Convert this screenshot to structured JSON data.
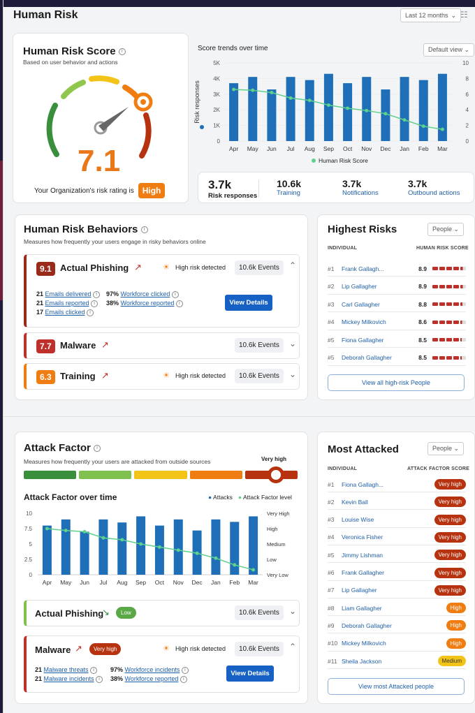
{
  "header": {
    "title": "Human Risk",
    "period": "Last 12 months"
  },
  "score_card": {
    "title": "Human Risk Score",
    "subtitle": "Based on user behavior and actions",
    "value": "7.1",
    "rating_text": "Your Organization's risk rating is",
    "rating": "High"
  },
  "trend": {
    "title": "Score trends over time",
    "view": "Default view",
    "ylabel": "Risk responses",
    "legend": "Human Risk Score",
    "stats": [
      {
        "value": "3.7k",
        "label": "Risk responses"
      },
      {
        "value": "10.6k",
        "label": "Training"
      },
      {
        "value": "3.7k",
        "label": "Notifications"
      },
      {
        "value": "3.7k",
        "label": "Outbound actions"
      }
    ]
  },
  "chart_data": [
    {
      "type": "bar",
      "title": "Score trends over time",
      "ylabel": "Risk responses",
      "categories": [
        "Apr",
        "May",
        "Jun",
        "Jul",
        "Aug",
        "Sep",
        "Oct",
        "Nov",
        "Dec",
        "Jan",
        "Feb",
        "Mar"
      ],
      "ylim": [
        0,
        5000
      ],
      "y2lim": [
        0,
        10
      ],
      "y_ticks": [
        "0",
        "1K",
        "2K",
        "3K",
        "4K",
        "5K"
      ],
      "y2_ticks": [
        "0",
        "2",
        "4",
        "6",
        "8",
        "10"
      ],
      "series": [
        {
          "name": "Risk responses",
          "values": [
            3700,
            4100,
            3300,
            4100,
            3900,
            4300,
            3700,
            4100,
            3300,
            4100,
            3900,
            4300
          ]
        },
        {
          "name": "Human Risk Score",
          "type": "line",
          "values": [
            6.6,
            6.5,
            6.2,
            5.5,
            5.2,
            4.6,
            4.2,
            3.9,
            3.5,
            2.7,
            1.9,
            1.5
          ]
        }
      ]
    },
    {
      "type": "bar",
      "title": "Attack Factor over time",
      "categories": [
        "Apr",
        "May",
        "Jun",
        "Jul",
        "Aug",
        "Sep",
        "Oct",
        "Nov",
        "Dec",
        "Jan",
        "Feb",
        "Mar"
      ],
      "ylim": [
        0,
        10
      ],
      "y_ticks": [
        "0",
        "2.5",
        "5",
        "7.5",
        "10"
      ],
      "y2_ticks": [
        "Very Low",
        "Low",
        "Medium",
        "High",
        "Very High"
      ],
      "series": [
        {
          "name": "Attacks",
          "values": [
            8.0,
            9.0,
            7.0,
            9.0,
            8.5,
            9.5,
            8.0,
            9.0,
            7.2,
            9.0,
            8.6,
            9.5
          ]
        },
        {
          "name": "Attack Factor level",
          "type": "line",
          "values": [
            7.5,
            7.2,
            7.0,
            6.0,
            5.7,
            5.0,
            4.5,
            4.0,
            3.5,
            2.7,
            1.6,
            0.8
          ]
        }
      ]
    }
  ],
  "behaviors": {
    "title": "Human Risk Behaviors",
    "subtitle": "Measures how frequently your users engage in risky behaviors online",
    "items": [
      {
        "score": "9.1",
        "name": "Actual Phishing",
        "alert": "High risk detected",
        "events": "10.6k Events",
        "stats_left": [
          {
            "num": "21",
            "label": "Emails delivered"
          },
          {
            "num": "21",
            "label": "Emails reported"
          },
          {
            "num": "17",
            "label": "Emails clicked"
          }
        ],
        "stats_right": [
          {
            "num": "97%",
            "label": "Workforce clicked"
          },
          {
            "num": "38%",
            "label": "Workforce reported"
          }
        ],
        "button": "View Details"
      },
      {
        "score": "7.7",
        "name": "Malware",
        "events": "10.6k Events"
      },
      {
        "score": "6.3",
        "name": "Training",
        "alert": "High risk detected",
        "events": "10.6k Events"
      }
    ]
  },
  "highest": {
    "title": "Highest Risks",
    "filter": "People",
    "col1": "INDIVIDUAL",
    "col2": "HUMAN RISK SCORE",
    "button": "View all high-risk People",
    "rows": [
      {
        "rank": "#1",
        "name": "Frank Gallagh...",
        "score": "8.9"
      },
      {
        "rank": "#2",
        "name": "Lip Gallagher",
        "score": "8.9"
      },
      {
        "rank": "#3",
        "name": "Carl Gallagher",
        "score": "8.8"
      },
      {
        "rank": "#4",
        "name": "Mickey Milkovich",
        "score": "8.6"
      },
      {
        "rank": "#5",
        "name": "Fiona Gallagher",
        "score": "8.5"
      },
      {
        "rank": "#5",
        "name": "Deborah Gallagher",
        "score": "8.5"
      }
    ]
  },
  "attack": {
    "title": "Attack Factor",
    "subtitle": "Measures how frequently your users are attacked from outside sources",
    "level": "Very high",
    "chart_title": "Attack Factor over time",
    "legend1": "Attacks",
    "legend2": "Attack Factor level",
    "items": [
      {
        "name": "Actual Phishing",
        "badge": "Low",
        "events": "10.6k Events"
      },
      {
        "name": "Malware",
        "badge": "Very high",
        "alert": "High risk detected",
        "events": "10.6k Events",
        "stats_left": [
          {
            "num": "21",
            "label": "Malware threats"
          },
          {
            "num": "21",
            "label": "Malware incidents"
          }
        ],
        "stats_right": [
          {
            "num": "97%",
            "label": "Workforce incidents"
          },
          {
            "num": "38%",
            "label": "Workforce reported"
          }
        ],
        "button": "View Details"
      }
    ]
  },
  "attacked": {
    "title": "Most Attacked",
    "filter": "People",
    "col1": "INDIVIDUAL",
    "col2": "ATTACK FACTOR SCORE",
    "button": "View most Attacked people",
    "rows": [
      {
        "rank": "#1",
        "name": "Fiona Gallagh...",
        "level": "Very high"
      },
      {
        "rank": "#2",
        "name": "Kevin Ball",
        "level": "Very high"
      },
      {
        "rank": "#3",
        "name": "Louise Wise",
        "level": "Very high"
      },
      {
        "rank": "#4",
        "name": "Veronica Fisher",
        "level": "Very high"
      },
      {
        "rank": "#5",
        "name": "Jimmy Lishman",
        "level": "Very high"
      },
      {
        "rank": "#6",
        "name": "Frank Gallagher",
        "level": "Very high"
      },
      {
        "rank": "#7",
        "name": "Lip Gallagher",
        "level": "Very high"
      },
      {
        "rank": "#8",
        "name": "Liam Gallagher",
        "level": "High"
      },
      {
        "rank": "#9",
        "name": "Deborah Gallagher",
        "level": "High"
      },
      {
        "rank": "#10",
        "name": "Mickey Milkovich",
        "level": "High"
      },
      {
        "rank": "#11",
        "name": "Sheila Jackson",
        "level": "Medium"
      }
    ]
  },
  "colors": {
    "bar": "#1f6fb8",
    "line": "#5ed18c",
    "very_high": "#b7320f",
    "high": "#f07d12",
    "medium": "#f2c418"
  }
}
